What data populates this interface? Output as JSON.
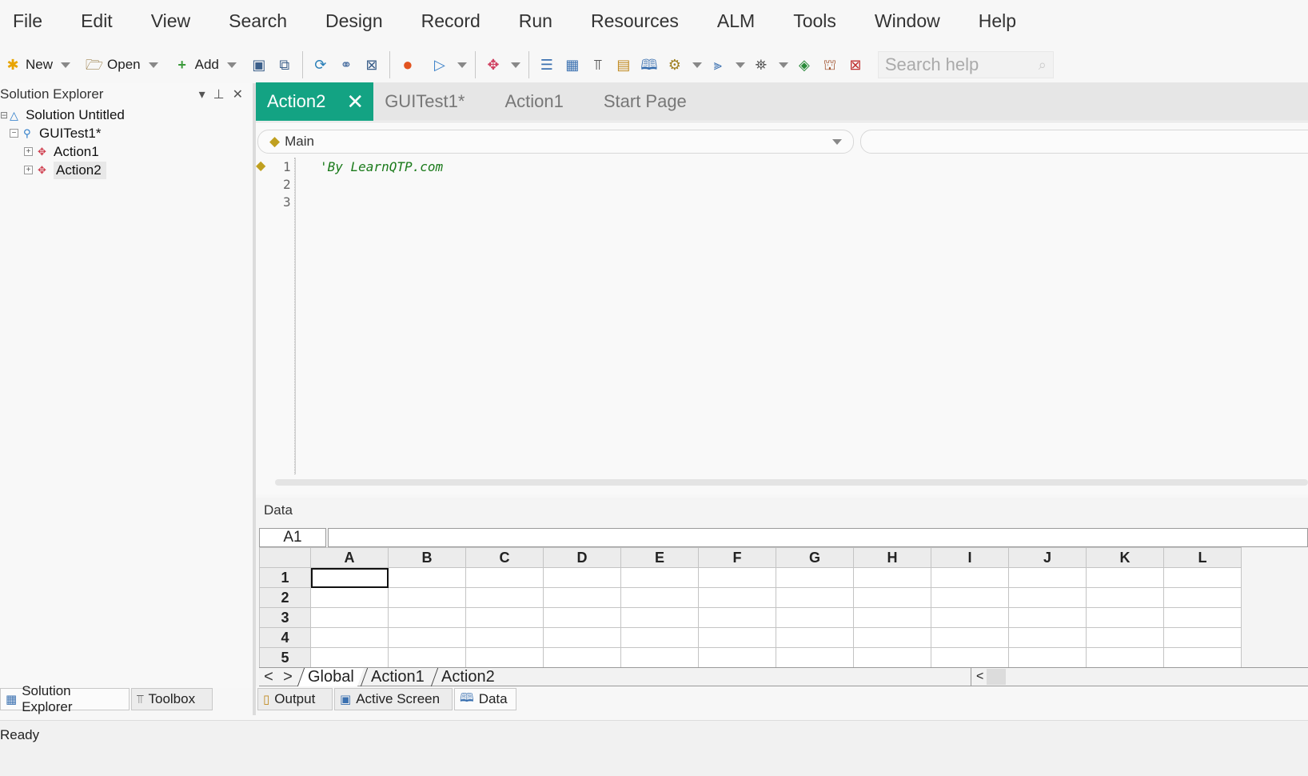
{
  "menu": [
    "File",
    "Edit",
    "View",
    "Search",
    "Design",
    "Record",
    "Run",
    "Resources",
    "ALM",
    "Tools",
    "Window",
    "Help"
  ],
  "toolbar": {
    "new_label": "New",
    "open_label": "Open",
    "add_label": "Add",
    "search_placeholder": "Search help"
  },
  "solution_explorer": {
    "title": "Solution Explorer",
    "tree": [
      {
        "label": "Solution Untitled",
        "level": 0
      },
      {
        "label": "GUITest1*",
        "level": 1
      },
      {
        "label": "Action1",
        "level": 2
      },
      {
        "label": "Action2",
        "level": 2,
        "selected": true
      }
    ]
  },
  "doc_tabs": [
    {
      "label": "Action2",
      "active": true
    },
    {
      "label": "GUITest1*"
    },
    {
      "label": "Action1"
    },
    {
      "label": "Start Page"
    }
  ],
  "editor": {
    "scope_combo": "Main",
    "line_numbers": [
      "1",
      "2",
      "3"
    ],
    "code_line_1": "'By LearnQTP.com"
  },
  "data_pane": {
    "title": "Data",
    "cell_ref": "A1",
    "columns": [
      "A",
      "B",
      "C",
      "D",
      "E",
      "F",
      "G",
      "H",
      "I",
      "J",
      "K",
      "L"
    ],
    "rows": [
      "1",
      "2",
      "3",
      "4",
      "5"
    ],
    "sheets": [
      "Global",
      "Action1",
      "Action2"
    ]
  },
  "bottom_tabs_left": [
    "Solution Explorer",
    "Toolbox"
  ],
  "bottom_tabs_right": [
    "Output",
    "Active Screen",
    "Data"
  ],
  "status": "Ready",
  "colors": {
    "accent_tab": "#13a383",
    "code_comment": "#1a7a1a"
  }
}
